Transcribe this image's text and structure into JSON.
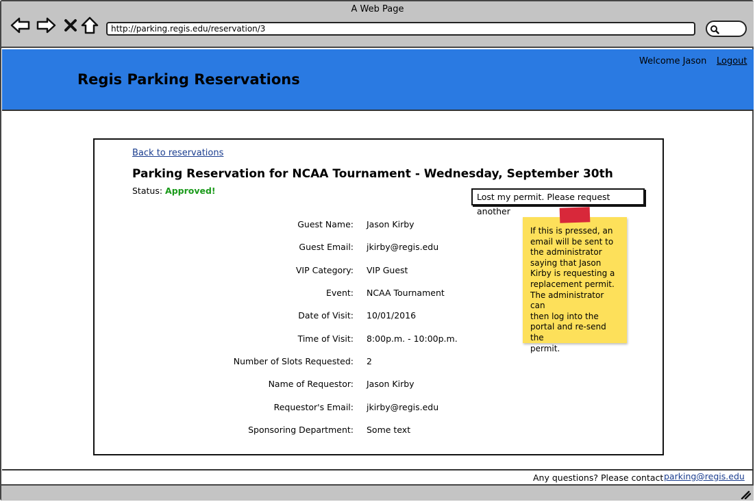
{
  "browser": {
    "window_title": "A Web Page",
    "url": "http://parking.regis.edu/reservation/3"
  },
  "header": {
    "site_title": "Regis Parking Reservations",
    "welcome": "Welcome Jason",
    "logout": "Logout",
    "background_color": "#2a7ae2"
  },
  "reservation": {
    "back_link": "Back to reservations",
    "title": "Parking Reservation for NCAA Tournament - Wednesday, September 30th",
    "status_label": "Status:",
    "status_value": "Approved!",
    "status_color": "#1a9a1a",
    "permit_button": "Lost my permit. Please request another",
    "fields": [
      {
        "label": "Guest Name:",
        "value": "Jason Kirby"
      },
      {
        "label": "Guest Email:",
        "value": "jkirby@regis.edu"
      },
      {
        "label": "VIP Category:",
        "value": "VIP Guest"
      },
      {
        "label": "Event:",
        "value": "NCAA Tournament"
      },
      {
        "label": "Date of Visit:",
        "value": "10/01/2016"
      },
      {
        "label": "Time of Visit:",
        "value": "8:00p.m. - 10:00p.m."
      },
      {
        "label": "Number of Slots Requested:",
        "value": "2"
      },
      {
        "label": "Name of Requestor:",
        "value": "Jason Kirby"
      },
      {
        "label": "Requestor's Email:",
        "value": "jkirby@regis.edu"
      },
      {
        "label": "Sponsoring Department:",
        "value": "Some text"
      }
    ]
  },
  "sticky_note": {
    "lines": [
      "If this is pressed, an",
      "email will be sent to",
      "the administrator",
      "saying that Jason",
      "Kirby is requesting a",
      "replacement permit.",
      "The administrator can",
      "then log into the",
      "portal and re-send the",
      "permit."
    ]
  },
  "footer": {
    "text": "Any questions? Please contact",
    "email": "parking@regis.edu"
  },
  "icons": {
    "back": "arrow-left-icon",
    "forward": "arrow-right-icon",
    "stop": "close-icon",
    "home": "home-icon",
    "search": "search-icon",
    "resize": "resize-grip-icon"
  }
}
